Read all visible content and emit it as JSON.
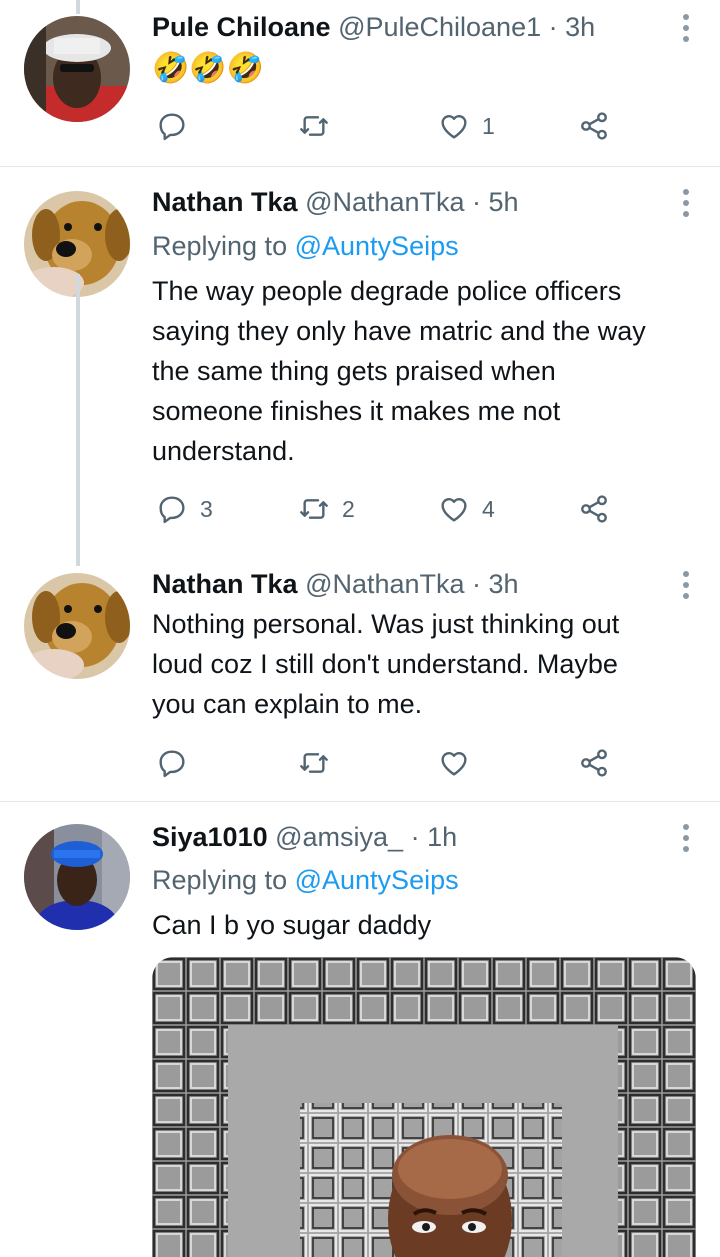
{
  "tweets": [
    {
      "name": "Pule Chiloane",
      "meta": "@PuleChiloane1 · 3h",
      "emoji": "🤣🤣🤣",
      "actions": {
        "replies": "",
        "retweets": "",
        "likes": "1"
      }
    },
    {
      "name": "Nathan Tka",
      "meta": "@NathanTka · 5h",
      "replying_prefix": "Replying to",
      "replying_handle": "@AuntySeips",
      "text_lines": [
        "The way people degrade police officers",
        "saying they only have matric and the way",
        "the same thing gets praised when",
        "someone finishes it makes me not",
        "understand."
      ],
      "actions": {
        "replies": "3",
        "retweets": "2",
        "likes": "4"
      }
    },
    {
      "name": "Nathan Tka",
      "meta": "@NathanTka · 3h",
      "text_lines": [
        "Nothing personal. Was just thinking out",
        "loud coz I still don't understand. Maybe",
        "you can explain to me."
      ],
      "actions": {
        "replies": "",
        "retweets": "",
        "likes": ""
      }
    },
    {
      "name": "Siya1010",
      "meta": "@amsiya_ · 1h",
      "replying_prefix": "Replying to",
      "replying_handle": "@AuntySeips",
      "text_lines": [
        "Can I b yo sugar daddy"
      ]
    }
  ],
  "icons": {
    "reply": "reply-icon",
    "retweet": "retweet-icon",
    "like": "heart-icon",
    "share": "share-icon",
    "more": "more-icon"
  },
  "colors": {
    "link": "#1d9bf0",
    "muted": "#536471",
    "text": "#0f1419",
    "thread": "#cfd9de"
  }
}
